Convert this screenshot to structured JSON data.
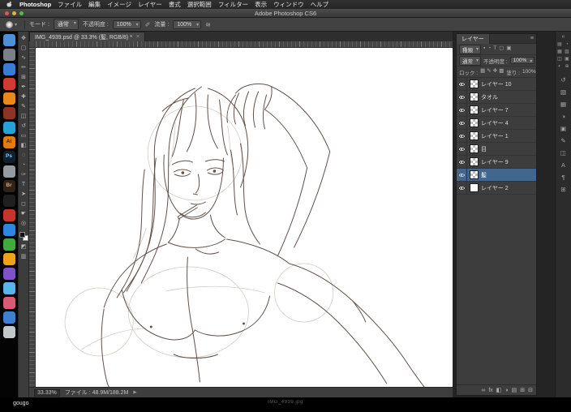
{
  "menu_bar": {
    "app_name": "Photoshop",
    "items": [
      "ファイル",
      "編集",
      "イメージ",
      "レイヤー",
      "書式",
      "選択範囲",
      "フィルター",
      "表示",
      "ウィンドウ",
      "ヘルプ"
    ]
  },
  "title_bar": {
    "title": "Adobe Photoshop CS6"
  },
  "options_bar": {
    "mode_label": "モード :",
    "mode_value": "通常",
    "opacity_label": "不透明度 :",
    "opacity_value": "100%",
    "flow_label": "流量 :",
    "flow_value": "100%",
    "airbrush_icon": "≋",
    "pressure_icon": "✐"
  },
  "document_tab": {
    "title": "IMG_4939.psd @ 33.3% (髪, RGB/8) *",
    "close_icon": "×"
  },
  "status_bar": {
    "zoom": "33.33%",
    "file_info": "ファイル : 48.9M/188.2M",
    "arrow_icon": "▶"
  },
  "layers_panel": {
    "tab_label": "レイヤー",
    "panel_menu_icon": "≡",
    "filter_label": "種類",
    "filter_icons": [
      {
        "name": "filter-pixel-icon",
        "glyph": "▪"
      },
      {
        "name": "filter-adjustment-icon",
        "glyph": "◔"
      },
      {
        "name": "filter-type-icon",
        "glyph": "T"
      },
      {
        "name": "filter-shape-icon",
        "glyph": "▢"
      },
      {
        "name": "filter-smart-object-icon",
        "glyph": "▣"
      }
    ],
    "blend_mode": "通常",
    "opacity_label": "不透明度 :",
    "opacity_value": "100%",
    "lock_label": "ロック :",
    "lock_icons": [
      {
        "name": "lock-transparency-icon",
        "glyph": "▦"
      },
      {
        "name": "lock-pixels-icon",
        "glyph": "✎"
      },
      {
        "name": "lock-position-icon",
        "glyph": "✥"
      },
      {
        "name": "lock-all-icon",
        "glyph": "▩"
      }
    ],
    "fill_label": "塗り :",
    "fill_value": "100%",
    "selection_color": "#41668f",
    "layers": [
      {
        "name": "レイヤー 10"
      },
      {
        "name": "タオル"
      },
      {
        "name": "レイヤー 7"
      },
      {
        "name": "レイヤー 4"
      },
      {
        "name": "レイヤー 1"
      },
      {
        "name": "目"
      },
      {
        "name": "レイヤー 9"
      },
      {
        "name": "髪",
        "selected": true
      },
      {
        "name": "レイヤー 2",
        "thumb_white": true
      }
    ],
    "bottom_icons": [
      {
        "name": "link-layers-icon",
        "glyph": "∞"
      },
      {
        "name": "layer-effects-icon",
        "glyph": "fx"
      },
      {
        "name": "layer-mask-icon",
        "glyph": "◧"
      },
      {
        "name": "adjustment-layer-icon",
        "glyph": "◑"
      },
      {
        "name": "layer-group-icon",
        "glyph": "▤"
      },
      {
        "name": "new-layer-icon",
        "glyph": "⊞"
      },
      {
        "name": "delete-layer-icon",
        "glyph": "⊟"
      }
    ]
  },
  "tools": {
    "main": [
      {
        "name": "move-tool",
        "glyph": "✥"
      },
      {
        "name": "marquee-tool",
        "glyph": "▢"
      },
      {
        "name": "lasso-tool",
        "glyph": "∿"
      },
      {
        "name": "quick-selection-tool",
        "glyph": "✏"
      },
      {
        "name": "crop-tool",
        "glyph": "⊞"
      },
      {
        "name": "eyedropper-tool",
        "glyph": "✒"
      },
      {
        "name": "healing-brush-tool",
        "glyph": "✚"
      },
      {
        "name": "brush-tool",
        "glyph": "✎"
      },
      {
        "name": "clone-stamp-tool",
        "glyph": "◫"
      },
      {
        "name": "history-brush-tool",
        "glyph": "↺"
      },
      {
        "name": "eraser-tool",
        "glyph": "▭"
      },
      {
        "name": "gradient-tool",
        "glyph": "◧"
      },
      {
        "name": "blur-tool",
        "glyph": "◌"
      },
      {
        "name": "dodge-tool",
        "glyph": "◔"
      },
      {
        "name": "pen-tool",
        "glyph": "✑"
      },
      {
        "name": "type-tool",
        "glyph": "T"
      },
      {
        "name": "path-selection-tool",
        "glyph": "➤"
      },
      {
        "name": "shape-tool",
        "glyph": "◻"
      },
      {
        "name": "hand-tool",
        "glyph": "☛"
      },
      {
        "name": "zoom-tool",
        "glyph": "◎"
      }
    ],
    "lower": [
      {
        "name": "quick-mask-tool",
        "glyph": "◩"
      },
      {
        "name": "screen-mode-tool",
        "glyph": "▥"
      }
    ]
  },
  "dock": {
    "apps": [
      {
        "name": "finder-icon",
        "color": "#4f8fd6"
      },
      {
        "name": "dock-app-icon-2",
        "color": "#7b8087"
      },
      {
        "name": "dock-app-icon-3",
        "color": "#3a7bd5"
      },
      {
        "name": "dock-app-icon-4",
        "color": "#d23b2f"
      },
      {
        "name": "dock-app-icon-5",
        "color": "#e8891a"
      },
      {
        "name": "dock-app-icon-6",
        "color": "#8e3326"
      },
      {
        "name": "dock-app-icon-7",
        "color": "#28a0d8"
      },
      {
        "name": "illustrator-icon",
        "color": "#e17c0e",
        "label": "Ai",
        "label_color": "#3a2400"
      },
      {
        "name": "photoshop-icon",
        "color": "#10202f",
        "label": "Ps",
        "label_color": "#8ecdf2"
      },
      {
        "name": "dock-app-icon-10",
        "color": "#969ba1"
      },
      {
        "name": "bridge-icon",
        "color": "#2e2219",
        "label": "Br",
        "label_color": "#d3ab76"
      },
      {
        "name": "dock-app-icon-12",
        "color": "#1f1f1f"
      },
      {
        "name": "dock-app-icon-13",
        "color": "#c6352b"
      },
      {
        "name": "dock-app-icon-14",
        "color": "#2f86e0"
      },
      {
        "name": "dock-app-icon-15",
        "color": "#43a93f"
      },
      {
        "name": "dock-app-icon-16",
        "color": "#efa21c"
      },
      {
        "name": "dock-app-icon-17",
        "color": "#8052c8"
      },
      {
        "name": "dock-app-icon-18",
        "color": "#5ab4e6"
      },
      {
        "name": "dock-app-icon-19",
        "color": "#d85a74"
      },
      {
        "name": "dock-app-icon-20",
        "color": "#3e7fd0"
      },
      {
        "name": "trash-icon",
        "color": "#c2c7cc"
      }
    ]
  },
  "right_strip": {
    "expander_icon": "«",
    "grid_icons": [
      {
        "name": "panel-dock-icon-1",
        "glyph": "▤"
      },
      {
        "name": "panel-dock-icon-2",
        "glyph": "◔"
      },
      {
        "name": "panel-dock-icon-3",
        "glyph": "▦"
      },
      {
        "name": "panel-dock-icon-4",
        "glyph": "▧"
      },
      {
        "name": "panel-dock-icon-5",
        "glyph": "◫"
      },
      {
        "name": "panel-dock-icon-6",
        "glyph": "▣"
      },
      {
        "name": "panel-dock-icon-7",
        "glyph": "◐"
      },
      {
        "name": "panel-dock-icon-8",
        "glyph": "⊕"
      }
    ],
    "column_icons": [
      {
        "name": "history-panel-icon",
        "glyph": "↺"
      },
      {
        "name": "color-panel-icon",
        "glyph": "▧"
      },
      {
        "name": "swatches-panel-icon",
        "glyph": "▦"
      },
      {
        "name": "adjustments-panel-icon",
        "glyph": "◑"
      },
      {
        "name": "styles-panel-icon",
        "glyph": "▣"
      },
      {
        "name": "brush-panel-icon",
        "glyph": "✎"
      },
      {
        "name": "clone-source-panel-icon",
        "glyph": "◫"
      },
      {
        "name": "character-panel-icon",
        "glyph": "A"
      },
      {
        "name": "paragraph-panel-icon",
        "glyph": "¶"
      },
      {
        "name": "navigator-panel-icon",
        "glyph": "⊞"
      }
    ]
  },
  "desktop": {
    "username": "gougo",
    "artifact_text": "IMG_4939.jpg"
  }
}
